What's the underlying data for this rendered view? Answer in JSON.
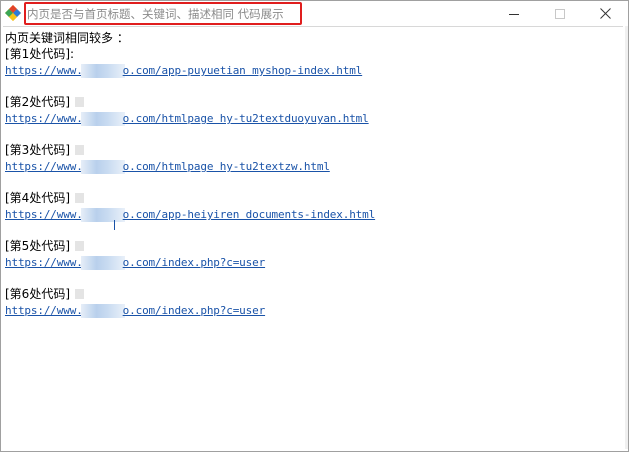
{
  "window": {
    "title": "内页是否与首页标题、关键词、描述相同 代码展示"
  },
  "icons": {
    "app": "app-logo-icon",
    "minimize": "minimize-icon",
    "maximize": "maximize-icon",
    "close": "close-icon"
  },
  "colors": {
    "highlight_border": "#e01e1e",
    "link": "#1a53a8",
    "title_text": "#8a8a8a"
  },
  "content": {
    "heading": "内页关键词相同较多 ：",
    "blocks": [
      {
        "label": "[第1处代码]:",
        "url_prefix": "https://www.",
        "url_suffix": "o.com/app-puyuetian myshop-index.html"
      },
      {
        "label": "[第2处代码]",
        "url_prefix": "https://www.",
        "url_suffix": "o.com/htmlpage hy-tu2textduoyuyan.html"
      },
      {
        "label": "[第3处代码]",
        "url_prefix": "https://www.",
        "url_suffix": "o.com/htmlpage hy-tu2textzw.html"
      },
      {
        "label": "[第4处代码]",
        "url_prefix": "https://www.",
        "url_suffix": "o.com/app-heiyiren documents-index.html"
      },
      {
        "label": "[第5处代码]",
        "url_prefix": "https://www.",
        "url_suffix": "o.com/index.php?c=user"
      },
      {
        "label": "[第6处代码]",
        "url_prefix": "https://www.",
        "url_suffix": "o.com/index.php?c=user"
      }
    ]
  }
}
